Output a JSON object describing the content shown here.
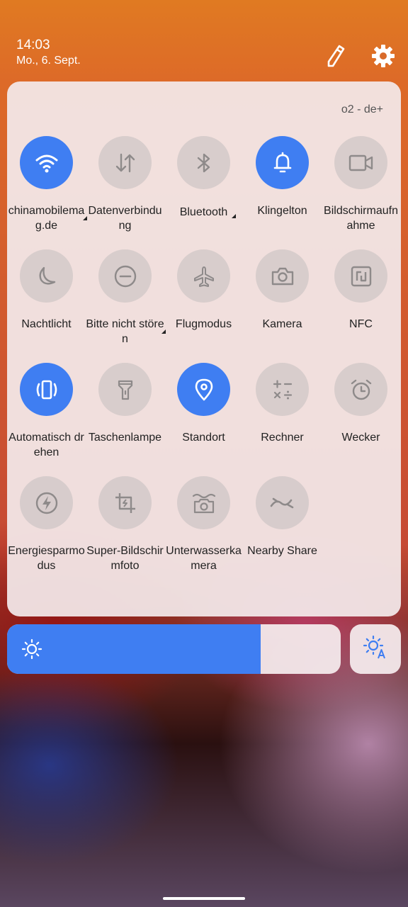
{
  "status": {
    "time": "14:03",
    "date": "Mo., 6. Sept."
  },
  "carrier": "o2 - de+",
  "tiles": [
    {
      "label": "chinamobilemag.de",
      "on": true,
      "icon": "wifi-icon"
    },
    {
      "label": "Datenverbindung",
      "on": false,
      "icon": "data-arrows-icon"
    },
    {
      "label": "Bluetooth",
      "on": false,
      "icon": "bluetooth-icon"
    },
    {
      "label": "Klingelton",
      "on": true,
      "icon": "bell-icon"
    },
    {
      "label": "Bildschirmaufnahme",
      "on": false,
      "icon": "video-camera-icon"
    },
    {
      "label": "Nachtlicht",
      "on": false,
      "icon": "moon-icon"
    },
    {
      "label": "Bitte nicht stören",
      "on": false,
      "icon": "do-not-disturb-icon"
    },
    {
      "label": "Flugmodus",
      "on": false,
      "icon": "airplane-icon"
    },
    {
      "label": "Kamera",
      "on": false,
      "icon": "camera-icon"
    },
    {
      "label": "NFC",
      "on": false,
      "icon": "nfc-icon"
    },
    {
      "label": "Automatisch drehen",
      "on": true,
      "icon": "auto-rotate-icon"
    },
    {
      "label": "Taschenlampe",
      "on": false,
      "icon": "flashlight-icon"
    },
    {
      "label": "Standort",
      "on": true,
      "icon": "location-pin-icon"
    },
    {
      "label": "Rechner",
      "on": false,
      "icon": "calculator-icon"
    },
    {
      "label": "Wecker",
      "on": false,
      "icon": "alarm-clock-icon"
    },
    {
      "label": "Energiesparmodus",
      "on": false,
      "icon": "battery-saver-icon"
    },
    {
      "label": "Super-Bildschirmfoto",
      "on": false,
      "icon": "screenshot-crop-icon"
    },
    {
      "label": "Unterwasserkamera",
      "on": false,
      "icon": "underwater-camera-icon"
    },
    {
      "label": "Nearby Share",
      "on": false,
      "icon": "nearby-share-icon"
    }
  ],
  "brightness": {
    "level": 0.76,
    "icon": "sun-icon",
    "auto_icon": "auto-brightness-icon"
  },
  "colors": {
    "accent": "#3f7ef2",
    "tile_off": "#c3bebe",
    "text": "#222222"
  }
}
